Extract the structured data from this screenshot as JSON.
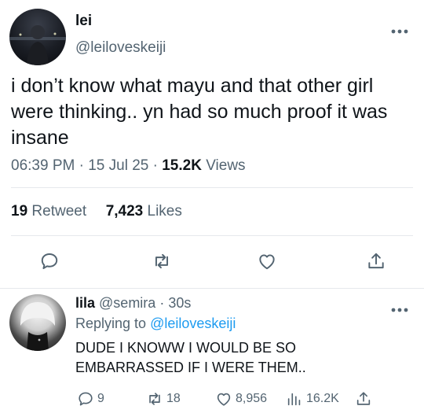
{
  "tweet": {
    "display_name": "lei",
    "handle": "@leiloveskeiji",
    "text": "i don’t know what mayu and that other girl were thinking.. yn had so much proof it was insane",
    "time": "06:39 PM",
    "date": "15 Jul 25",
    "views_count": "15.2K",
    "views_label": "Views",
    "retweet_count": "19",
    "retweet_label": "Retweet",
    "likes_count": "7,423",
    "likes_label": "Likes",
    "more_icon": "more-horizontal-icon"
  },
  "reply": {
    "display_name": "lila",
    "handle": "@semira",
    "age": "30s",
    "replying_prefix": "Replying to",
    "replying_to": "@leiloveskeiji",
    "text": "DUDE I KNOWW I WOULD BE SO EMBARRASSED IF I WERE THEM..",
    "reply_count": "9",
    "retweet_count": "18",
    "like_count": "8,956",
    "view_count": "16.2K"
  },
  "colors": {
    "text": "#0f1419",
    "secondary": "#536471",
    "link": "#1d9bf0",
    "divider": "#e6e9ec"
  }
}
